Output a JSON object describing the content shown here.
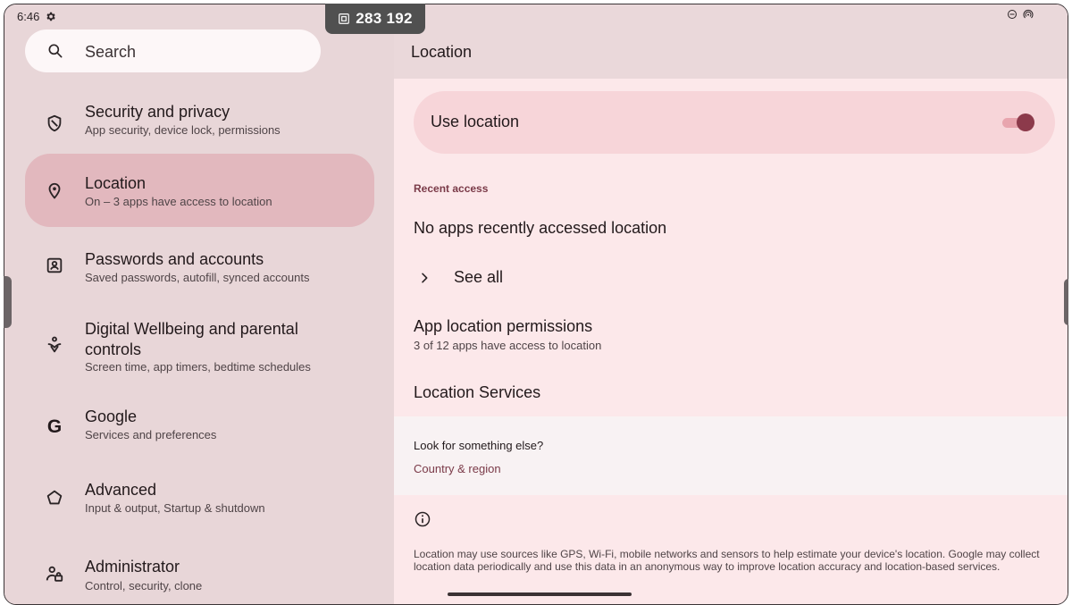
{
  "status": {
    "time": "6:46",
    "left_icons": [
      "settings-gear-icon"
    ],
    "right_icons": [
      "do-not-disturb-icon",
      "hotspot-icon"
    ]
  },
  "counter": {
    "icon": "screen-record-icon",
    "value": "283 192"
  },
  "search": {
    "label": "Search",
    "icon": "search-icon"
  },
  "nav": {
    "items": [
      {
        "title": "Security and privacy",
        "subtitle": "App security, device lock, permissions",
        "icon": "shield-icon",
        "active": false
      },
      {
        "title": "Location",
        "subtitle": "On – 3 apps have access to location",
        "icon": "location-pin-icon",
        "active": true
      },
      {
        "title": "Passwords and accounts",
        "subtitle": "Saved passwords, autofill, synced accounts",
        "icon": "account-box-icon",
        "active": false
      },
      {
        "title": "Digital Wellbeing and parental controls",
        "subtitle": "Screen time, app timers, bedtime schedules",
        "icon": "wellbeing-icon",
        "active": false
      },
      {
        "title": "Google",
        "subtitle": "Services and preferences",
        "icon": "google-icon",
        "active": false
      },
      {
        "title": "Advanced",
        "subtitle": "Input & output, Startup & shutdown",
        "icon": "advanced-icon",
        "active": false
      },
      {
        "title": "Administrator",
        "subtitle": "Control, security, clone",
        "icon": "admin-icon",
        "active": false
      }
    ]
  },
  "detail": {
    "title": "Location",
    "use_location": {
      "label": "Use location",
      "enabled": true
    },
    "recent_access": {
      "label": "Recent access",
      "empty_text": "No apps recently accessed location",
      "see_all": "See all"
    },
    "app_permissions": {
      "title": "App location permissions",
      "subtitle": "3 of 12 apps have access to location"
    },
    "location_services": "Location Services",
    "look_for": {
      "question": "Look for something else?",
      "link": "Country & region"
    },
    "footer": "Location may use sources like GPS, Wi-Fi, mobile networks and sensors to help estimate your device's location. Google may collect location data periodically and use this data in an anonymous way to improve location accuracy and location-based services."
  },
  "colors": {
    "accent": "#8c3a4b",
    "active_item_bg": "#e2b8be",
    "panel_bg": "#fce8ea"
  }
}
